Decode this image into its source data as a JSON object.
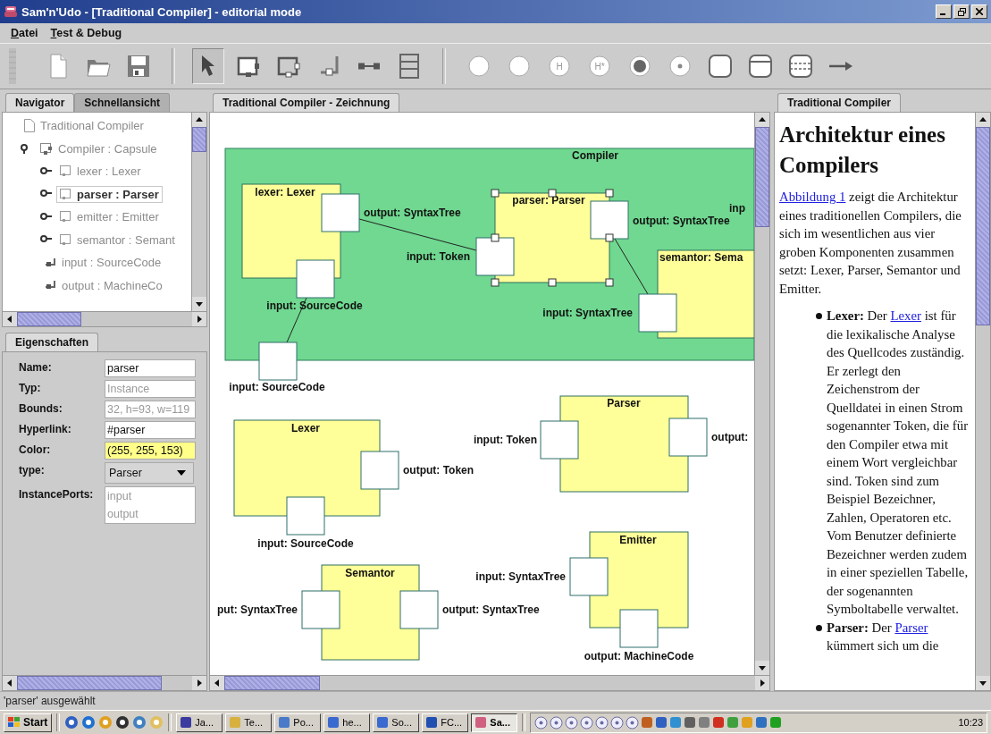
{
  "window": {
    "title": "Sam'n'Udo - [Traditional Compiler] - editorial mode"
  },
  "menu": [
    {
      "label": "Datei"
    },
    {
      "label": "Test & Debug"
    }
  ],
  "toolbar": [
    {
      "selected": false
    },
    {
      "selected": false
    },
    {
      "selected": false
    },
    {
      "selected": true
    },
    {
      "selected": false
    },
    {
      "selected": false
    },
    {
      "selected": false
    },
    {
      "selected": false
    },
    {
      "selected": false
    },
    {
      "selected": false
    },
    {
      "selected": false
    },
    {
      "selected": false,
      "glyph": "H"
    },
    {
      "selected": false,
      "glyph": "H*"
    },
    {
      "selected": false
    },
    {
      "selected": false
    },
    {
      "selected": false
    },
    {
      "selected": false
    },
    {
      "selected": false
    },
    {
      "selected": false
    }
  ],
  "navigator": {
    "tabs": [
      {
        "label": "Navigator",
        "selected": true
      },
      {
        "label": "Schnellansicht",
        "selected": false
      }
    ],
    "tree": [
      {
        "label": "Traditional Compiler",
        "kind": "document",
        "selected": false
      },
      {
        "label": "Compiler : Capsule",
        "kind": "capsule",
        "selected": false,
        "expanded": true,
        "children": [
          {
            "label": "lexer : Lexer",
            "kind": "instance",
            "selected": false,
            "expanded": false
          },
          {
            "label": "parser : Parser",
            "kind": "instance",
            "selected": true,
            "expanded": false
          },
          {
            "label": "emitter : Emitter",
            "kind": "instance",
            "selected": false,
            "expanded": false
          },
          {
            "label": "semantor : Semant",
            "kind": "instance",
            "selected": false,
            "expanded": false
          },
          {
            "label": "input : SourceCode",
            "kind": "port",
            "selected": false
          },
          {
            "label": "output : MachineCo",
            "kind": "port",
            "selected": false
          }
        ]
      }
    ]
  },
  "properties": {
    "tab": "Eigenschaften",
    "rows": [
      {
        "label": "Name:",
        "kind": "text",
        "value": "parser"
      },
      {
        "label": "Typ:",
        "kind": "readonly",
        "value": "Instance"
      },
      {
        "label": "Bounds:",
        "kind": "readonly",
        "value": "32, h=93, w=119"
      },
      {
        "label": "Hyperlink:",
        "kind": "text",
        "value": "#parser"
      },
      {
        "label": "Color:",
        "kind": "color",
        "value": "(255, 255, 153)"
      },
      {
        "label": "type:",
        "kind": "select",
        "value": "Parser"
      },
      {
        "label": "InstancePorts:",
        "kind": "list",
        "values": [
          "input",
          "output"
        ]
      }
    ]
  },
  "editor": {
    "tab": "Traditional Compiler - Zeichnung",
    "diagram": {
      "capsule": {
        "title": "Compiler",
        "outer_ports": [
          {
            "label": "input: SourceCode"
          }
        ],
        "instances": [
          {
            "title": "lexer: Lexer",
            "selected": false,
            "ports": [
              {
                "label": "output: SyntaxTree"
              },
              {
                "label": "input: SourceCode"
              }
            ]
          },
          {
            "title": "parser: Parser",
            "selected": true,
            "ports": [
              {
                "label": "input: Token"
              },
              {
                "label": "output: SyntaxTree"
              }
            ]
          },
          {
            "title": "semantor: Sema",
            "selected": false,
            "ports": [
              {
                "label": "input: SyntaxTree"
              },
              {
                "label": "inp"
              }
            ]
          }
        ]
      },
      "classes": [
        {
          "title": "Lexer",
          "ports": [
            {
              "label": "output: Token"
            },
            {
              "label": "input: SourceCode"
            }
          ]
        },
        {
          "title": "Parser",
          "ports": [
            {
              "label": "input: Token"
            },
            {
              "label": "output:"
            }
          ]
        },
        {
          "title": "Semantor",
          "ports": [
            {
              "label": "put: SyntaxTree"
            },
            {
              "label": "output: SyntaxTree"
            }
          ]
        },
        {
          "title": "Emitter",
          "ports": [
            {
              "label": "input: SyntaxTree"
            },
            {
              "label": "output: MachineCode"
            }
          ]
        }
      ]
    }
  },
  "document": {
    "tab": "Traditional Compiler",
    "heading": "Architektur eines Compilers",
    "intro": {
      "link": "Abbildung 1",
      "text": " zeigt die Architektur eines traditionellen Compilers, die sich im wesentlichen aus vier groben Komponenten zusammen setzt: Lexer, Parser, Semantor und Emitter."
    },
    "items": [
      {
        "term": "Lexer:",
        "before": " Der ",
        "link": "Lexer",
        "after": " ist für die lexikalische Analyse des Quellcodes zuständig. Er zerlegt den Zeichenstrom der Quelldatei in einen Strom sogenannter Token, die für den Compiler etwa mit einem Wort vergleichbar sind. Token sind zum Beispiel Bezeichner, Zahlen, Operatoren etc. Vom Benutzer definierte Bezeichner werden zudem in einer speziellen Tabelle, der sogenannten Symboltabelle verwaltet."
      },
      {
        "term": "Parser:",
        "before": " Der ",
        "link": "Parser",
        "after": " kümmert sich um die"
      }
    ]
  },
  "status_bar": "'parser' ausgewählt",
  "taskbar": {
    "start": "Start",
    "tasks": [
      {
        "label": "Ja...",
        "selected": false
      },
      {
        "label": "Te...",
        "selected": false
      },
      {
        "label": "Po...",
        "selected": false
      },
      {
        "label": "he...",
        "selected": false
      },
      {
        "label": "So...",
        "selected": false
      },
      {
        "label": "FC...",
        "selected": false
      },
      {
        "label": "Sa...",
        "selected": true
      }
    ],
    "clock": "10:23"
  }
}
